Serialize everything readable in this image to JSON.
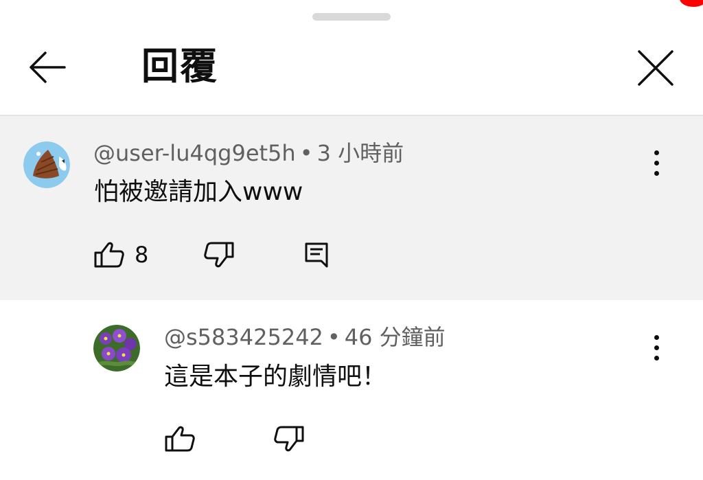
{
  "header": {
    "title": "回覆",
    "back_icon": "arrow-left-icon",
    "close_icon": "close-icon"
  },
  "comments": [
    {
      "author": "@user-lu4qg9et5h",
      "time": "3 小時前",
      "text": "怕被邀請加入www",
      "likes": "8",
      "avatar_icon": "bamboo-shoot-avatar"
    },
    {
      "author": "@s583425242",
      "time": "46 分鐘前",
      "text": "這是本子的劇情吧！",
      "avatar_icon": "violet-flower-avatar"
    }
  ],
  "separator": "•",
  "colors": {
    "parent_bg": "#f2f2f2",
    "meta_text": "#606060",
    "text": "#0f0f0f",
    "notification": "#ff0000"
  }
}
